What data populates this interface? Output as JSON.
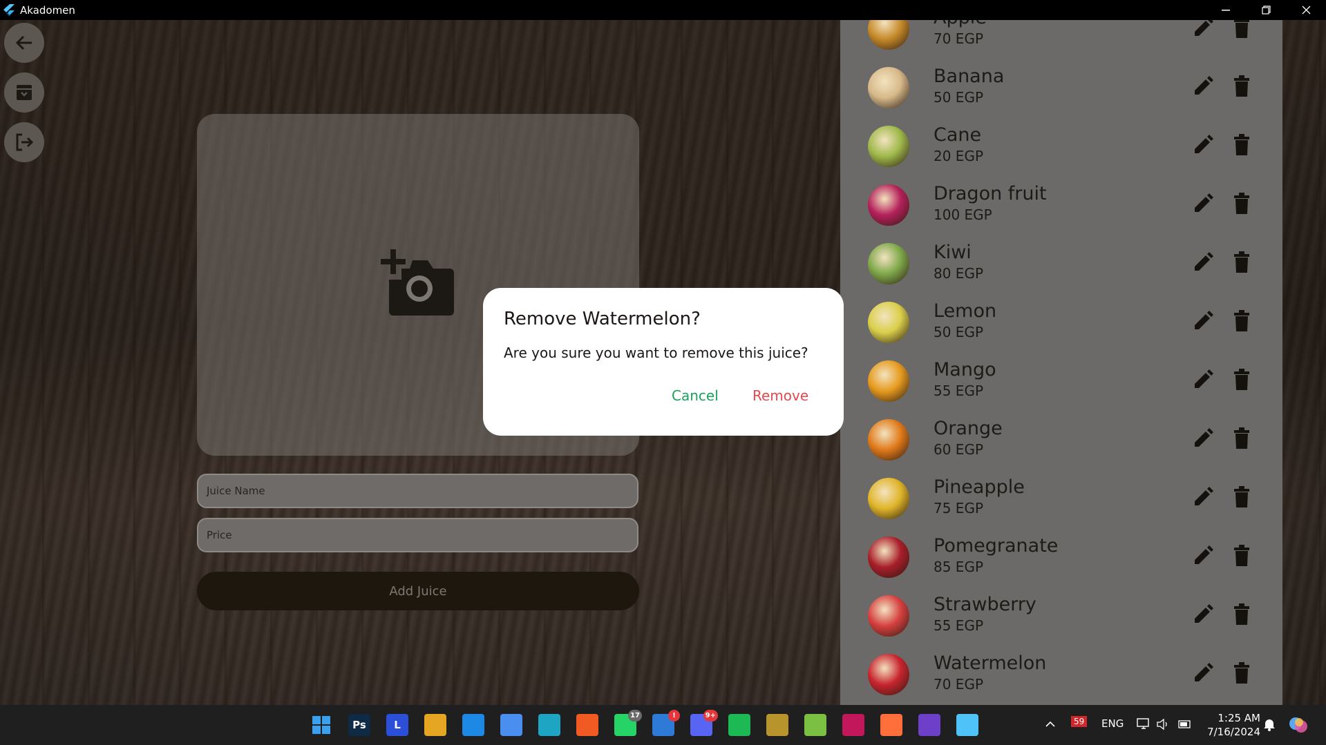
{
  "window": {
    "title": "Akadomen"
  },
  "form": {
    "name_placeholder": "Juice Name",
    "price_placeholder": "Price",
    "add_label": "Add Juice"
  },
  "juices": [
    {
      "name": "Apple",
      "price": "70 EGP",
      "color": "#c78a2a"
    },
    {
      "name": "Banana",
      "price": "50 EGP",
      "color": "#d7b98a"
    },
    {
      "name": "Cane",
      "price": "20 EGP",
      "color": "#9fb84a"
    },
    {
      "name": "Dragon fruit",
      "price": "100 EGP",
      "color": "#b4205a"
    },
    {
      "name": "Kiwi",
      "price": "80 EGP",
      "color": "#7fa84a"
    },
    {
      "name": "Lemon",
      "price": "50 EGP",
      "color": "#d9cf4a"
    },
    {
      "name": "Mango",
      "price": "55 EGP",
      "color": "#e69a1e"
    },
    {
      "name": "Orange",
      "price": "60 EGP",
      "color": "#e07a1a"
    },
    {
      "name": "Pineapple",
      "price": "75 EGP",
      "color": "#e0b52a"
    },
    {
      "name": "Pomegranate",
      "price": "85 EGP",
      "color": "#a81e2a"
    },
    {
      "name": "Strawberry",
      "price": "55 EGP",
      "color": "#d64040"
    },
    {
      "name": "Watermelon",
      "price": "70 EGP",
      "color": "#c8242e"
    }
  ],
  "dialog": {
    "title": "Remove Watermelon?",
    "message": "Are you sure you want to remove this juice?",
    "cancel_label": "Cancel",
    "remove_label": "Remove"
  },
  "taskbar": {
    "apps": [
      {
        "id": "start",
        "label": ""
      },
      {
        "id": "photoshop",
        "label": "Ps"
      },
      {
        "id": "app-l",
        "label": "L"
      },
      {
        "id": "microsoft-store",
        "label": ""
      },
      {
        "id": "vscode",
        "label": ""
      },
      {
        "id": "app-a",
        "label": ""
      },
      {
        "id": "edge",
        "label": ""
      },
      {
        "id": "brave",
        "label": ""
      },
      {
        "id": "whatsapp",
        "label": "",
        "badge": "17"
      },
      {
        "id": "office",
        "label": "",
        "badge": "!"
      },
      {
        "id": "discord",
        "label": "",
        "badge": "9+"
      },
      {
        "id": "spotify",
        "label": ""
      },
      {
        "id": "app-league",
        "label": ""
      },
      {
        "id": "app-green",
        "label": ""
      },
      {
        "id": "app-red",
        "label": ""
      },
      {
        "id": "app-orange",
        "label": ""
      },
      {
        "id": "github",
        "label": ""
      },
      {
        "id": "flutter",
        "label": ""
      }
    ],
    "tray_badge": "59",
    "language": "ENG",
    "time": "1:25 AM",
    "date": "7/16/2024"
  }
}
